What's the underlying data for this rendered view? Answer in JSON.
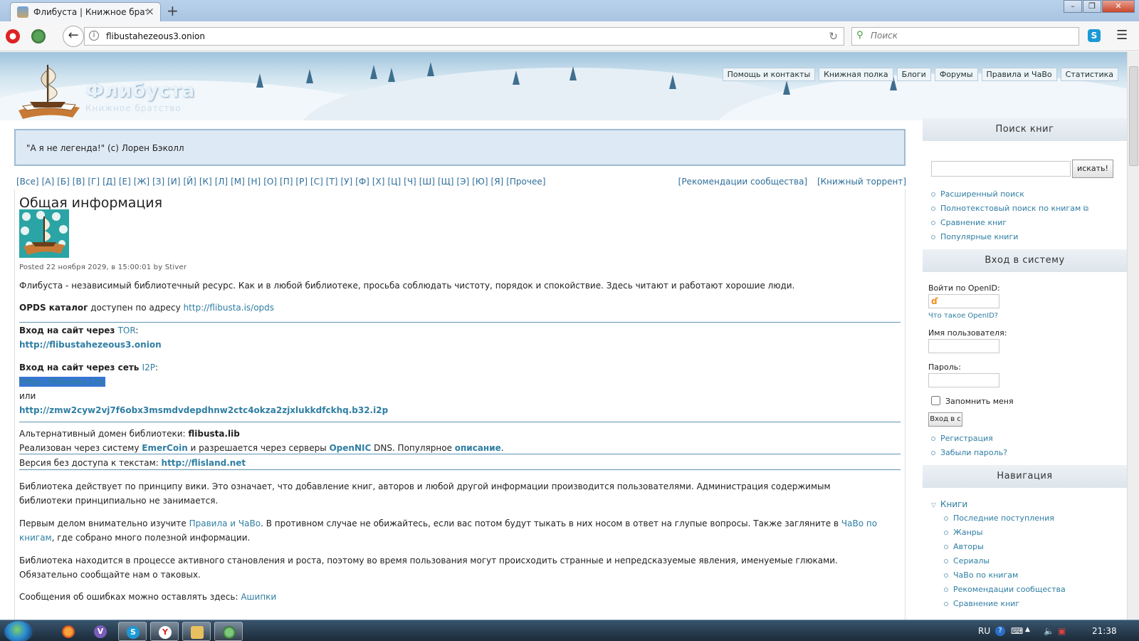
{
  "browser": {
    "tab_title": "Флибуста | Книжное брат...",
    "url": "flibustahezeous3.onion",
    "search_placeholder": "Поиск",
    "icons": [
      "browser-logo-icon",
      "addon-icon",
      "back-icon",
      "info-icon",
      "reload-icon",
      "search-icon",
      "skype-icon",
      "menu-icon"
    ]
  },
  "site": {
    "name": "Флибуста",
    "slogan": "Книжное братство",
    "top_tabs": [
      "Помощь и контакты",
      "Книжная полка",
      "Блоги",
      "Форумы",
      "Правила и ЧаВо",
      "Статистика"
    ]
  },
  "quote": "\"А я не легенда!\" (с) Лорен Бэколл",
  "alphabet": [
    "[Все]",
    "[А]",
    "[Б]",
    "[В]",
    "[Г]",
    "[Д]",
    "[Е]",
    "[Ж]",
    "[З]",
    "[И]",
    "[Й]",
    "[К]",
    "[Л]",
    "[М]",
    "[Н]",
    "[О]",
    "[П]",
    "[Р]",
    "[С]",
    "[Т]",
    "[У]",
    "[Ф]",
    "[Х]",
    "[Ц]",
    "[Ч]",
    "[Ш]",
    "[Щ]",
    "[Э]",
    "[Ю]",
    "[Я]",
    "[Прочее]"
  ],
  "alpha_right": [
    "[Рекомендации сообщества]",
    "[Книжный торрент]"
  ],
  "article": {
    "title": "Общая информация",
    "posted": "Posted 22 ноября 2029, в 15:00:01 by Stiver",
    "intro": "Флибуста - независимый библиотечный ресурс. Как и в любой библиотеке, просьба соблюдать чистоту, порядок и спокойствие. Здесь читают и работают хорошие люди.",
    "opds_label": "OPDS каталог",
    "opds_text": " доступен по адресу ",
    "opds_link": "http://flibusta.is/opds",
    "tor_label": "Вход на сайт через ",
    "tor_link": "TOR",
    "colon": ":",
    "tor_url": "http://flibustahezeous3.onion",
    "i2p_label": "Вход на сайт через сеть ",
    "i2p_link": "I2P",
    "i2p_url": "http://flibusta.i2p",
    "or": "или",
    "i2p_url2": "http://zmw2cyw2vj7f6obx3msmdvdepdhnw2ctc4okza2zjxlukkdfckhq.b32.i2p",
    "alt_domain_label": "Альтернативный домен библиотеки: ",
    "alt_domain": "flibusta.lib",
    "emer_1": "Реализован через систему ",
    "emer_link": "EmerCoin",
    "emer_2": " и разрешается через серверы ",
    "opennic_link": "OpenNIC",
    "emer_3": " DNS. Популярное ",
    "desc_link": "описание",
    "dot": ".",
    "noaccess_label": "Версия без доступа к текстам: ",
    "noaccess_link": "http://flisland.net",
    "wiki_1": "Библиотека действует по принципу вики. Это означает, что добавление книг, авторов и любой другой информации производится пользователями. Администрация содержимым",
    "wiki_2": "библиотеки принципиально не занимается.",
    "rules_1": "Первым делом внимательно изучите ",
    "rules_link": "Правила и ЧаВо",
    "rules_2": ". В противном случае не обижайтесь, если вас потом будут тыкать в них носом в ответ на глупые вопросы. Также загляните в ",
    "faq_link_a": "ЧаВо по",
    "faq_link_b": "книгам",
    "rules_3": ", где собрано много полезной информации.",
    "dev_1": "Библиотека находится в процессе активного становления и роста, поэтому во время пользования могут происходить странные и непредсказуемые явления, именуемые глюками.",
    "dev_2": "Обязательно сообщайте нам о таковых.",
    "errors_text": "Сообщения об ошибках можно оставлять здесь: ",
    "errors_link": "Ашипки"
  },
  "sidebar": {
    "search_title": "Поиск книг",
    "search_button": "искать!",
    "search_links": [
      "Расширенный поиск",
      "Полнотекстовый поиск по книгам",
      "Сравнение книг",
      "Популярные книги"
    ],
    "login_title": "Вход в систему",
    "openid_label": "Войти по OpenID:",
    "openid_help": "Что такое OpenID?",
    "username_label": "Имя пользователя:",
    "password_label": "Пароль:",
    "remember_label": "Запомнить меня",
    "login_button": "Вход в с",
    "login_links": [
      "Регистрация",
      "Забыли пароль?"
    ],
    "nav_title": "Навигация",
    "nav_root": "Книги",
    "nav_items": [
      "Последние поступления",
      "Жанры",
      "Авторы",
      "Сериалы",
      "ЧаВо по книгам",
      "Рекомендации сообщества",
      "Сравнение книг"
    ]
  },
  "taskbar": {
    "language": "RU",
    "clock": "21:38",
    "apps": [
      "firefox-icon",
      "viber-icon",
      "skype-icon",
      "yandex-icon",
      "explorer-icon",
      "tor-browser-icon"
    ]
  },
  "colors": {
    "link": "#2f7ea3",
    "header_sky": "#9fc3dc",
    "quote_bg": "#dde9f4",
    "selection": "#3875d7"
  }
}
